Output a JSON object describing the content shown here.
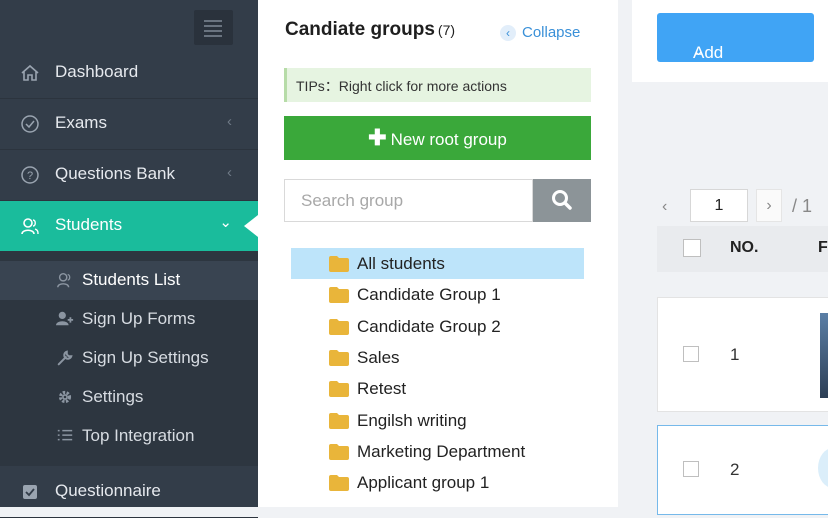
{
  "sidebar": {
    "nav": [
      {
        "label": "Dashboard",
        "icon": "home-icon"
      },
      {
        "label": "Exams",
        "icon": "check-circle-icon"
      },
      {
        "label": "Questions Bank",
        "icon": "question-circle-icon"
      },
      {
        "label": "Students",
        "icon": "users-icon"
      },
      {
        "label": "Questionnaire",
        "icon": "checkbox-icon"
      }
    ],
    "students_submenu": [
      {
        "label": "Students List",
        "icon": "users-icon"
      },
      {
        "label": "Sign Up Forms",
        "icon": "user-add-icon"
      },
      {
        "label": "Sign Up Settings",
        "icon": "wrench-icon"
      },
      {
        "label": "Settings",
        "icon": "gear-icon"
      },
      {
        "label": "Top Integration",
        "icon": "list-icon"
      }
    ],
    "accent_color": "#1abc9c"
  },
  "groups": {
    "title": "Candiate groups",
    "count": "(7)",
    "collapse_label": "Collapse",
    "tips": "TIPs：Right click for more actions",
    "new_root_group_label": "New root group",
    "search_placeholder": "Search group",
    "tree": [
      "All students",
      "Candidate Group 1",
      "Candidate Group 2",
      "Sales",
      "Retest",
      "Engilsh writing",
      "Marketing Department",
      "Applicant group 1"
    ]
  },
  "content": {
    "add_students_label": "Add students",
    "pager": {
      "current": "1",
      "total": "/ 1"
    },
    "table": {
      "header_no": "NO.",
      "header_next": "F",
      "rows": [
        "1",
        "2"
      ]
    }
  }
}
